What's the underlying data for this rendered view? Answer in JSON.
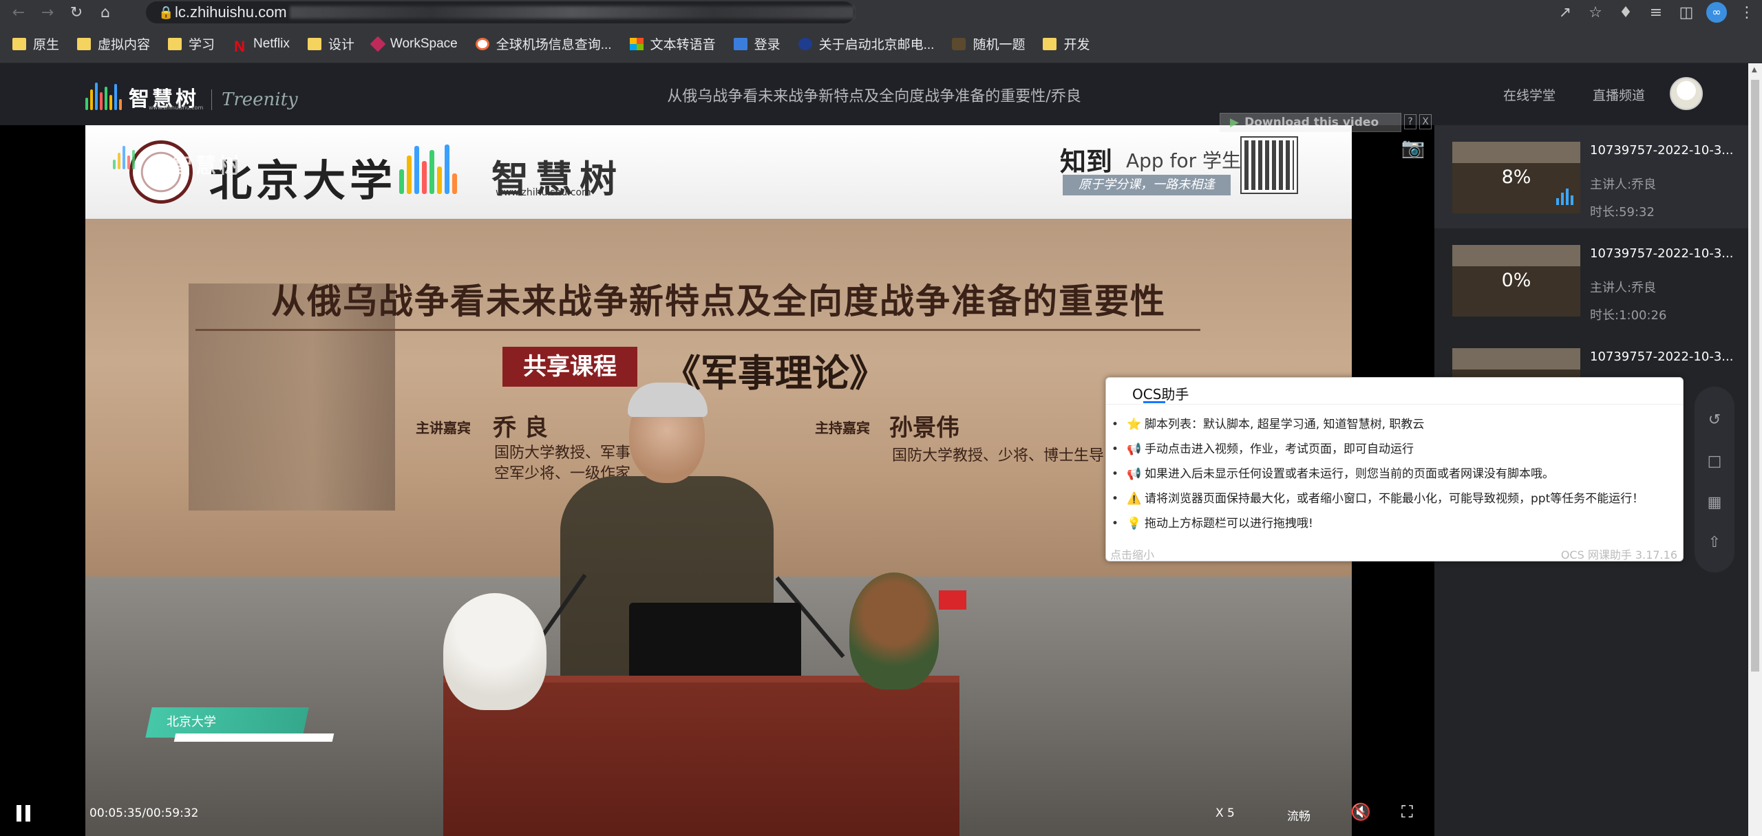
{
  "browser": {
    "url": "lc.zhihuishu.com",
    "bookmarks": [
      {
        "label": "原生",
        "icon": "folder-icon"
      },
      {
        "label": "虚拟内容",
        "icon": "folder-icon"
      },
      {
        "label": "学习",
        "icon": "folder-icon"
      },
      {
        "label": "Netflix",
        "icon": "netflix-icon"
      },
      {
        "label": "设计",
        "icon": "folder-icon"
      },
      {
        "label": "WorkSpace",
        "icon": "workspace-icon"
      },
      {
        "label": "全球机场信息查询...",
        "icon": "globe-icon"
      },
      {
        "label": "文本转语音",
        "icon": "microsoft-icon"
      },
      {
        "label": "登录",
        "icon": "login-icon"
      },
      {
        "label": "关于启动北京邮电...",
        "icon": "bupt-icon"
      },
      {
        "label": "随机一题",
        "icon": "random-icon"
      },
      {
        "label": "开发",
        "icon": "folder-icon"
      }
    ]
  },
  "header": {
    "logo_text": "智慧树",
    "logo_url": "www.zhihuishu.com",
    "brand_secondary": "Treenity",
    "course_title": "从俄乌战争看未来战争新特点及全向度战争准备的重要性/乔良",
    "nav": [
      "在线学堂",
      "直播频道"
    ]
  },
  "video": {
    "slide": {
      "university": "北京大学",
      "platform": "智慧树",
      "platform_url": "www.zhihuishu.com",
      "zhidao": "知到",
      "zhidao_app": "App for 学生",
      "zhidao_slogan": "原于学分课，一路未相逢",
      "talk_title": "从俄乌战争看未来战争新特点及全向度战争准备的重要性",
      "share_tag": "共享课程",
      "course_name": "《军事理论》",
      "speaker_label": "主讲嘉宾",
      "speaker_name": "乔 良",
      "speaker_desc_1": "国防大学教授、军事",
      "speaker_desc_2": "空军少将、一级作家",
      "host_label": "主持嘉宾",
      "host_name": "孙景伟",
      "host_desc": "国防大学教授、少将、博士生导"
    },
    "lower_third": "北京大学",
    "watermark": "智慧树",
    "download_label": "Download this video",
    "download_help": "?",
    "download_close": "X",
    "time": "00:05:35/00:59:32",
    "progress": 0.094,
    "speed": "X 5",
    "quality": "流畅"
  },
  "playlist": [
    {
      "title": "10739757-2022-10-3...",
      "speaker": "主讲人:乔良",
      "duration": "时长:59:32",
      "progress": "8%",
      "active": true
    },
    {
      "title": "10739757-2022-10-3...",
      "speaker": "主讲人:乔良",
      "duration": "时长:1:00:26",
      "progress": "0%",
      "active": false
    },
    {
      "title": "10739757-2022-10-3...",
      "speaker": "",
      "duration": "",
      "progress": "",
      "active": false
    }
  ],
  "ocs": {
    "tab": "OCS助手",
    "items": [
      {
        "emoji": "⭐",
        "text": "脚本列表：默认脚本, 超星学习通, 知道智慧树, 职教云"
      },
      {
        "emoji": "📢",
        "text": "手动点击进入视频，作业，考试页面，即可自动运行"
      },
      {
        "emoji": "📢",
        "text": "如果进入后未显示任何设置或者未运行，则您当前的页面或者网课没有脚本哦。"
      },
      {
        "emoji": "⚠️",
        "text": "请将浏览器页面保持最大化，或者缩小窗口，不能最小化，可能导致视频，ppt等任务不能运行！"
      },
      {
        "emoji": "💡",
        "text": "拖动上方标题栏可以进行拖拽哦!"
      }
    ],
    "footer_left": "点击缩小",
    "footer_right": "OCS 网课助手 3.17.16"
  },
  "colors": {
    "accent_blue": "#1677ff",
    "progress_blue": "#3ba7ff",
    "lower_third_teal": "#46c8a8",
    "share_tag_red": "#8a1f22"
  }
}
